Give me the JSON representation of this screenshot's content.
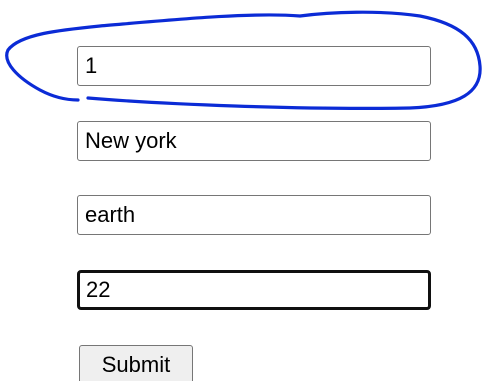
{
  "form": {
    "fields": [
      {
        "value": "1"
      },
      {
        "value": "New york"
      },
      {
        "value": "earth"
      },
      {
        "value": "22"
      }
    ],
    "submit_label": "Submit"
  },
  "annotation": {
    "color": "#0b2bd6",
    "shape": "hand-drawn-outline"
  }
}
